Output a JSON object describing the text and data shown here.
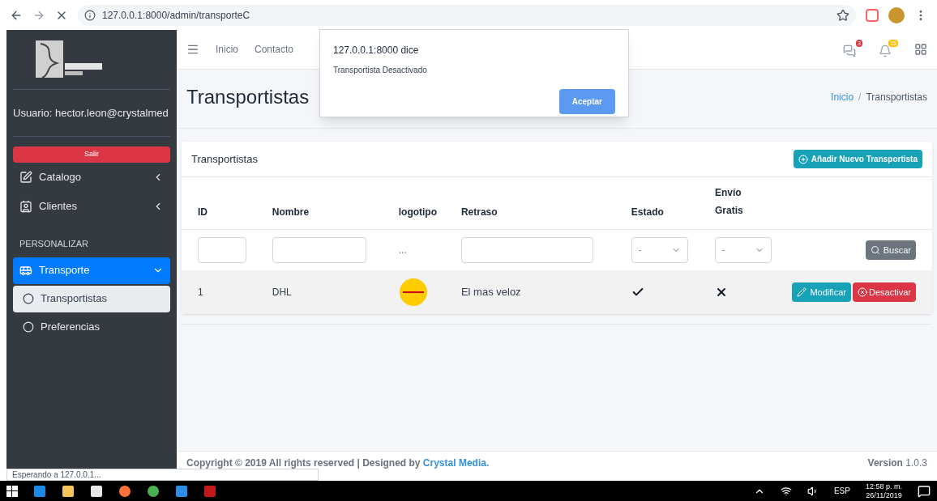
{
  "browser": {
    "url": "127.0.0.1:8000/admin/transporteC",
    "status_text": "Esperando a 127.0.0.1..."
  },
  "dialog": {
    "title": "127.0.0.1:8000 dice",
    "message": "Transportista Desactivado",
    "button": "Aceptar"
  },
  "navbar": {
    "links": [
      "Inicio",
      "Contacto"
    ],
    "badges": [
      {
        "count": "3",
        "color": "#dc3545"
      },
      {
        "count": "15",
        "color": "#ffc107"
      }
    ]
  },
  "sidebar": {
    "user": "Usuario: hector.leon@crystalmed",
    "logout": "Salir",
    "menu": [
      {
        "label": "Catalogo",
        "expanded": false
      },
      {
        "label": "Clientes",
        "expanded": false
      }
    ],
    "section": "PERSONALIZAR",
    "group": {
      "label": "Transporte",
      "expanded": true,
      "selected": true,
      "children": [
        {
          "label": "Transportistas",
          "selected": true
        },
        {
          "label": "Preferencias",
          "selected": false
        }
      ]
    }
  },
  "page": {
    "title": "Transportistas",
    "breadcrumb": [
      "Inicio",
      "Transportistas"
    ],
    "breadcrumb_separator": "/"
  },
  "card": {
    "title": "Transportistas",
    "add_button": "Añadir Nuevo Transportista",
    "columns": [
      "ID",
      "Nombre",
      "logotipo",
      "Retraso",
      "Estado",
      "Envío Gratis"
    ],
    "filters": {
      "logo_note": "...",
      "estado": "-",
      "envio": "-",
      "search_button": "Buscar"
    },
    "rows": [
      {
        "id": "1",
        "name": "DHL",
        "delay": "El mas veloz",
        "active": true,
        "free_shipping": false
      }
    ],
    "actions": [
      "Modificar",
      "Desactivar"
    ]
  },
  "footer": {
    "copyright": "Copyright © 2019 All rights reserved | Designed by",
    "brand": "Crystal Media.",
    "version_label": "Version",
    "version": "1.0.3"
  },
  "taskbar": {
    "language": "ESP",
    "time": "12:58 p. m.",
    "date": "26/11/2019"
  }
}
